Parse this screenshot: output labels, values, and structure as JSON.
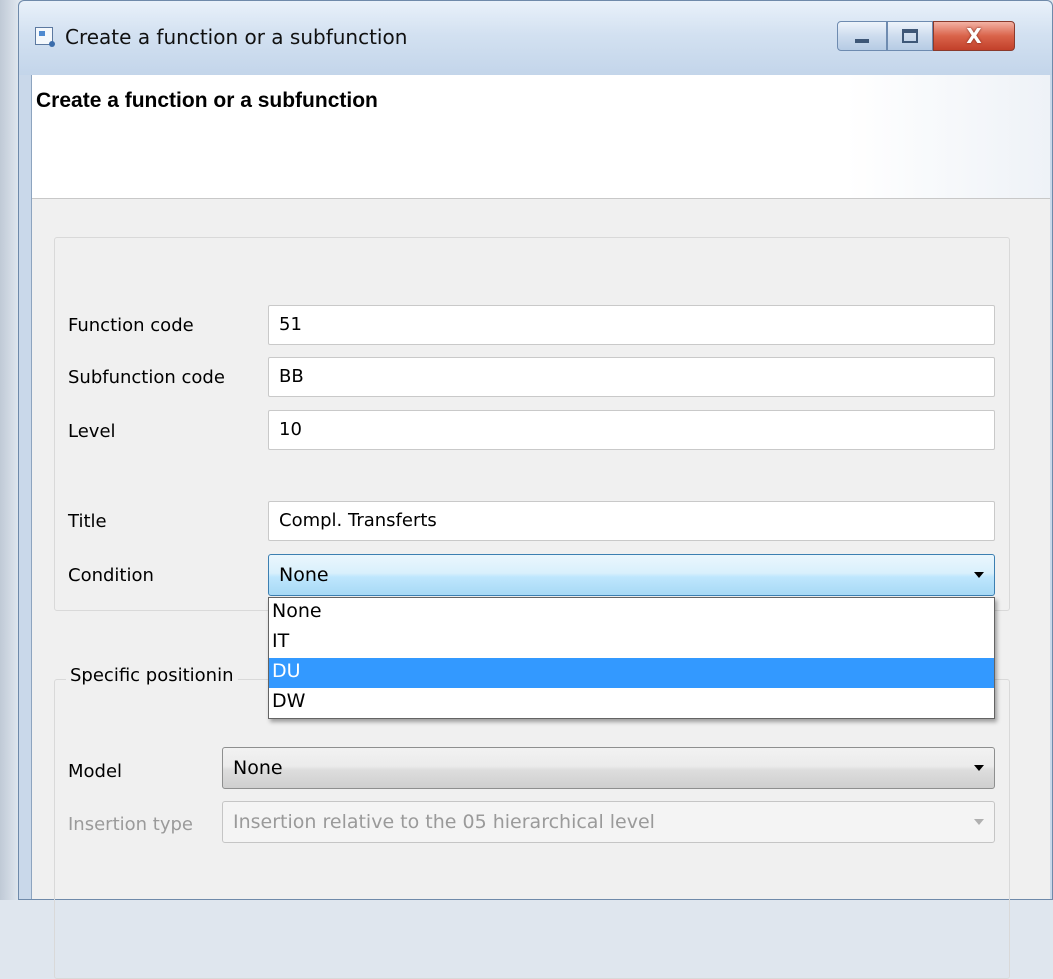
{
  "window": {
    "title": "Create a function or a subfunction",
    "controls": {
      "minimize": "minimize",
      "maximize": "maximize",
      "close": "X"
    }
  },
  "header": {
    "title": "Create a function or a subfunction"
  },
  "form": {
    "function_code": {
      "label": "Function code",
      "value": "51"
    },
    "subfunction_code": {
      "label": "Subfunction code",
      "value": "BB"
    },
    "level": {
      "label": "Level",
      "value": "10"
    },
    "title": {
      "label": "Title",
      "value": "Compl. Transferts"
    },
    "condition": {
      "label": "Condition",
      "value": "None",
      "options": [
        "None",
        "IT",
        "DU",
        "DW"
      ],
      "highlighted": "DU"
    }
  },
  "positioning": {
    "legend": "Specific positionin",
    "model": {
      "label": "Model",
      "value": "None"
    },
    "insertion_type": {
      "label": "Insertion type",
      "value": "Insertion relative to the 05 hierarchical level"
    }
  },
  "colors": {
    "selection": "#3399ff",
    "active_combo_border": "#3c7fb1"
  }
}
